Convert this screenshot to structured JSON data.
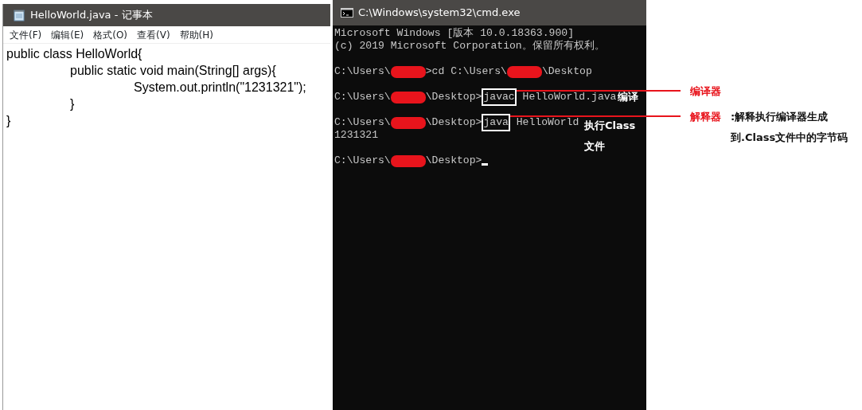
{
  "notepad": {
    "title": "HelloWorld.java - 记事本",
    "menu": [
      "文件(F)",
      "编辑(E)",
      "格式(O)",
      "查看(V)",
      "帮助(H)"
    ],
    "lines": [
      "public class HelloWorld{",
      "\tpublic static void main(String[] args){",
      "\t\tSystem.out.println(\"1231321\");",
      "\t}",
      "}"
    ]
  },
  "console": {
    "title": "C:\\Windows\\system32\\cmd.exe",
    "blocks": [
      [
        {
          "segments": [
            {
              "kind": "text",
              "text": "Microsoft Windows [版本 10.0.18363.900]"
            }
          ]
        },
        {
          "segments": [
            {
              "kind": "text",
              "text": "(c) 2019 Microsoft Corporation。保留所有权利。"
            }
          ]
        }
      ],
      [
        {
          "segments": [
            {
              "kind": "text",
              "text": "C:\\Users\\"
            },
            {
              "kind": "redaction"
            },
            {
              "kind": "text",
              "text": ">cd C:\\Users\\"
            },
            {
              "kind": "redaction"
            },
            {
              "kind": "text",
              "text": "\\Desktop"
            }
          ]
        }
      ],
      [
        {
          "segments": [
            {
              "kind": "text",
              "text": "C:\\Users\\"
            },
            {
              "kind": "redaction"
            },
            {
              "kind": "text",
              "text": "\\Desktop>"
            },
            {
              "kind": "boxed",
              "text": "javac"
            },
            {
              "kind": "text",
              "text": " HelloWorld.java"
            },
            {
              "kind": "note",
              "text": "编译"
            }
          ]
        }
      ],
      [
        {
          "segments": [
            {
              "kind": "text",
              "text": "C:\\Users\\"
            },
            {
              "kind": "redaction"
            },
            {
              "kind": "text",
              "text": "\\Desktop>"
            },
            {
              "kind": "boxed",
              "text": "java"
            },
            {
              "kind": "text",
              "text": " HelloWorld"
            }
          ]
        },
        {
          "segments": [
            {
              "kind": "text",
              "text": "1231321"
            }
          ]
        }
      ],
      [
        {
          "segments": [
            {
              "kind": "text",
              "text": "C:\\Users\\"
            },
            {
              "kind": "redaction"
            },
            {
              "kind": "text",
              "text": "\\Desktop>"
            },
            {
              "kind": "cursor"
            }
          ]
        }
      ]
    ],
    "side_note": [
      "执行Class",
      "文件"
    ]
  },
  "callouts": [
    {
      "label": "编译器"
    },
    {
      "label": "解释器",
      "description": ":解释执行编译器生成到.Class文件中的字节码"
    }
  ]
}
